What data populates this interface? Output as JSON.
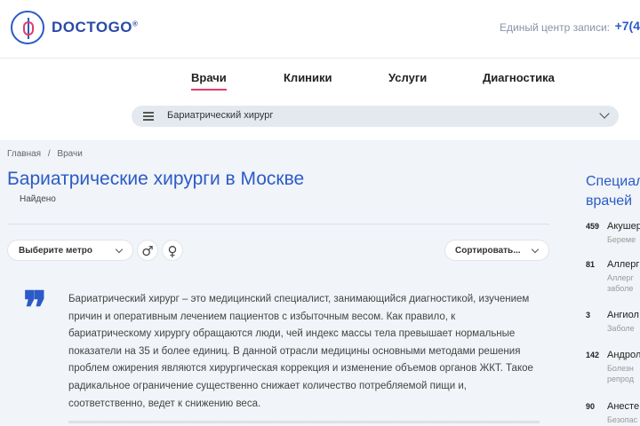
{
  "header": {
    "logo_text": "DOCTOGO",
    "logo_mark": "®",
    "callcenter_label": "Единый центр записи:",
    "phone": "+7(4"
  },
  "nav": {
    "items": [
      {
        "label": "Врачи",
        "active": true
      },
      {
        "label": "Клиники",
        "active": false
      },
      {
        "label": "Услуги",
        "active": false
      },
      {
        "label": "Диагностика",
        "active": false
      }
    ],
    "search_value": "Бариатрический хирург"
  },
  "breadcrumb": [
    "Главная",
    "Врачи"
  ],
  "breadcrumb_separator": "/",
  "page_title": "Бариатрические хирурги в Москве",
  "found_label": "Найдено",
  "filters": {
    "metro_label": "Выберите метро",
    "male_symbol": "♂",
    "female_symbol": "♀",
    "sort_label": "Сортировать..."
  },
  "quote_mark": "❞",
  "description": "Бариатрический хирург – это медицинский специалист, занимающийся диагностикой, изучением причин и оперативным лечением пациентов с избыточным весом. Как правило, к бариатрическому хирургу обращаются люди, чей индекс массы тела превышает нормальные показатели на 35 и более единиц. В данной отрасли медицины основными методами решения проблем ожирения являются хирургическая коррекция и изменение объемов органов ЖКТ. Такое радикальное ограничение существенно снижает количество потребляемой пищи и, соответственно, ведет к снижению веса.",
  "sidebar": {
    "title_line1": "Специал",
    "title_line2": "врачей",
    "specialties": [
      {
        "count": "459",
        "name": "Акушер",
        "sub1": "Береме",
        "sub2": ""
      },
      {
        "count": "81",
        "name": "Аллерг",
        "sub1": "Аллерг",
        "sub2": "заболе"
      },
      {
        "count": "3",
        "name": "Ангиол",
        "sub1": "Заболе",
        "sub2": ""
      },
      {
        "count": "142",
        "name": "Андрол",
        "sub1": "Болезн",
        "sub2": "репрод"
      },
      {
        "count": "90",
        "name": "Анесте",
        "sub1": "Безопас",
        "sub2": ""
      }
    ]
  },
  "colors": {
    "accent": "#2c5bc7",
    "active_underline": "#e23b6a",
    "background": "#f1f4f8"
  }
}
